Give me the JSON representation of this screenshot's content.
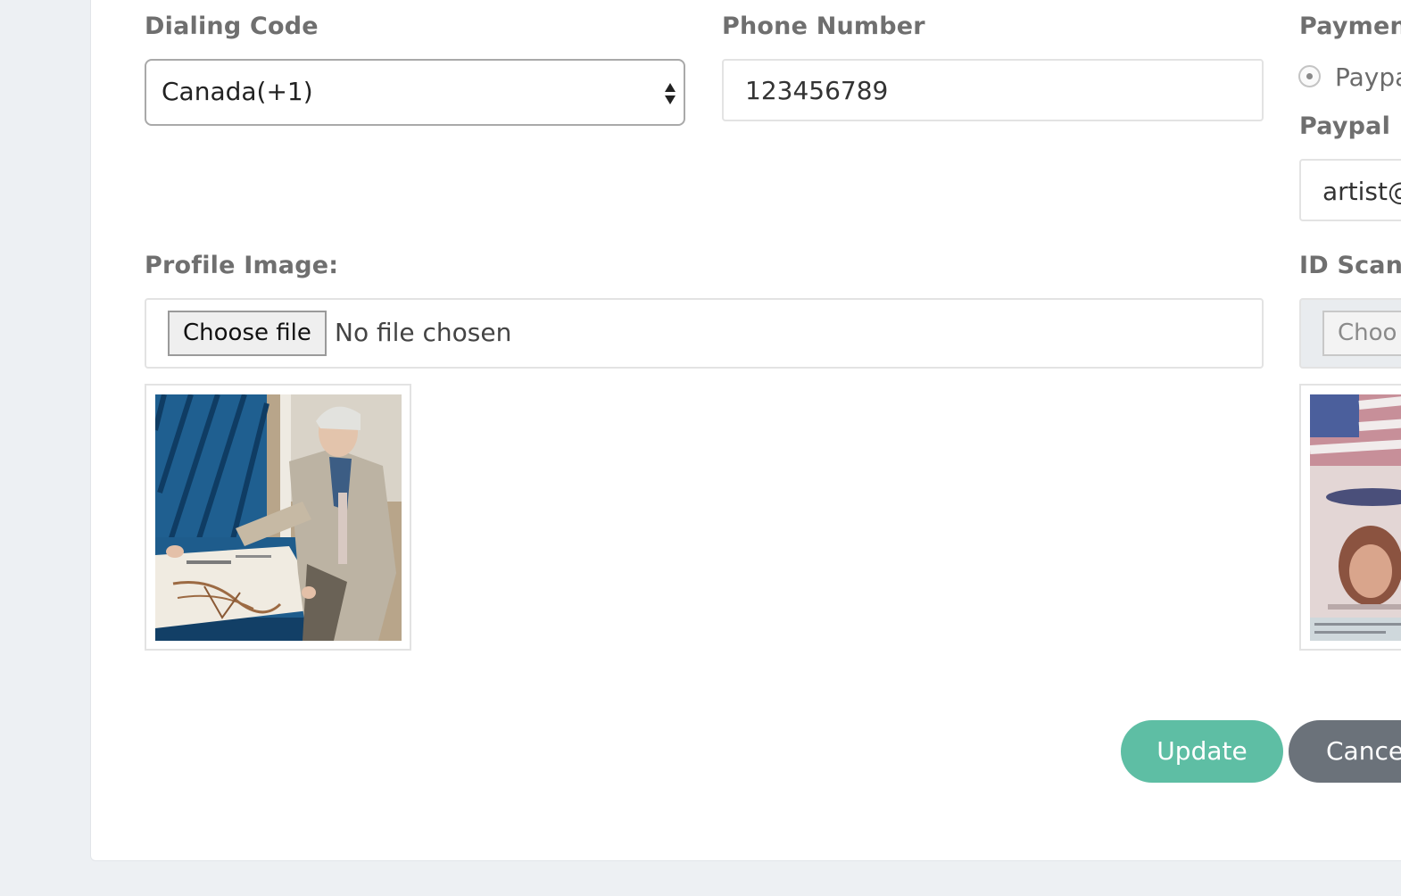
{
  "form": {
    "dialing_code": {
      "label": "Dialing Code",
      "selected": "Canada(+1)"
    },
    "phone_number": {
      "label": "Phone Number",
      "value": "123456789"
    },
    "payment": {
      "label": "Paymen",
      "option_label": "Paypa",
      "paypal_email_label": "Paypal E",
      "paypal_email_value": "artist@"
    },
    "profile_image": {
      "label": "Profile Image:",
      "button": "Choose file",
      "status": "No file chosen"
    },
    "id_scan": {
      "label": "ID Scan:",
      "button": "Choo"
    }
  },
  "actions": {
    "update": "Update",
    "cancel": "Cance"
  },
  "colors": {
    "update": "#5ebea4",
    "cancel": "#6b727a",
    "label": "#6f6f6f",
    "background": "#edf0f3"
  }
}
